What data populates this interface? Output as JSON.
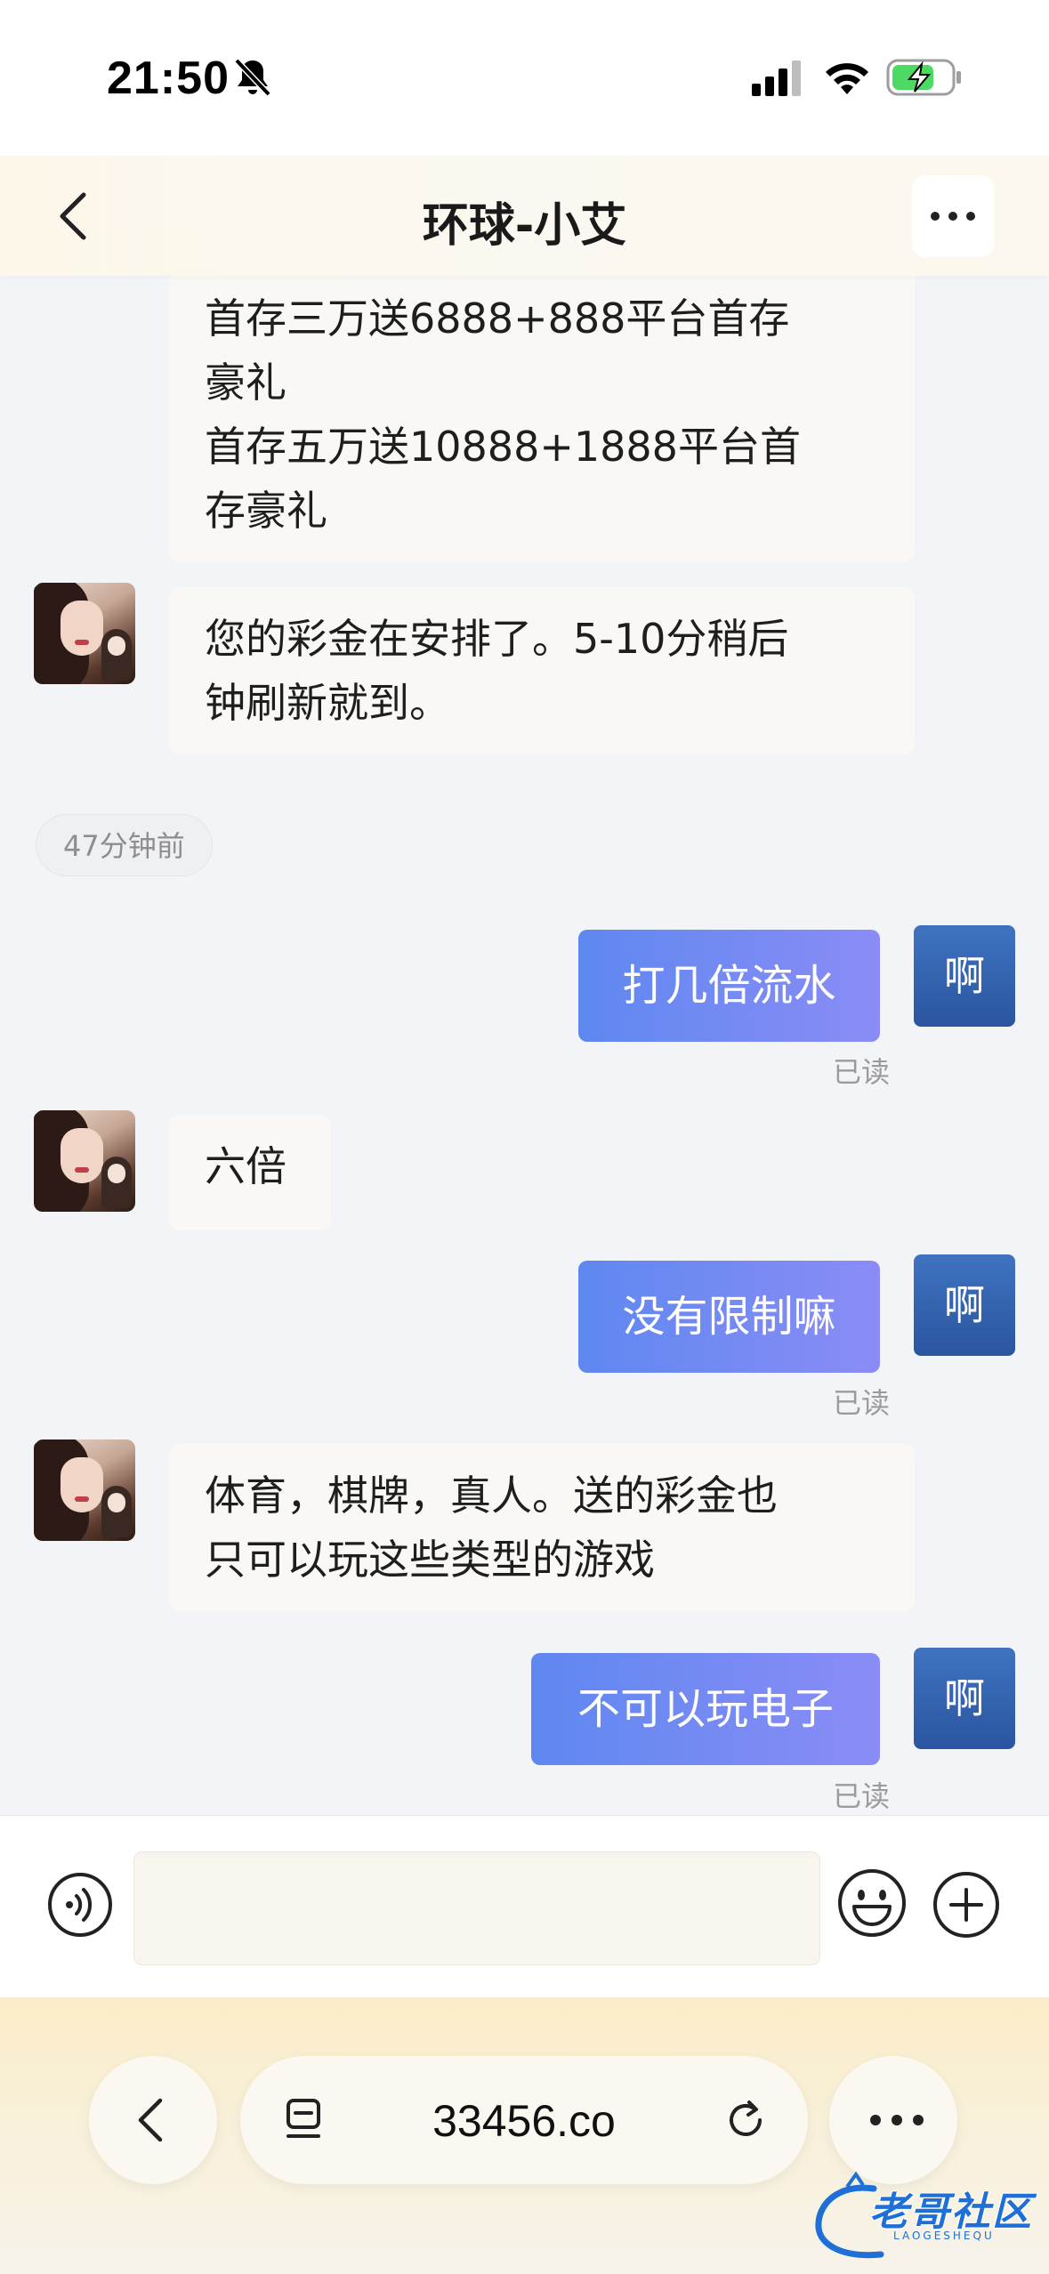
{
  "status_bar": {
    "time": "21:50"
  },
  "header": {
    "title": "环球-小艾"
  },
  "messages": {
    "m0": {
      "line1": "首存三万送6888+888平台首存",
      "line2": "豪礼",
      "line3": "首存五万送10888+1888平台首",
      "line4": "存豪礼"
    },
    "m1": {
      "line1": "您的彩金在安排了。5-10分稍后",
      "line2": "钟刷新就到。"
    },
    "time_chip": "47分钟前",
    "m2": {
      "text": "打几倍流水",
      "read": "已读"
    },
    "m3": {
      "text": "六倍"
    },
    "m4": {
      "text": "没有限制嘛",
      "read": "已读"
    },
    "m5": {
      "line1": "体育，棋牌，真人。送的彩金也",
      "line2": "只可以玩这些类型的游戏"
    },
    "m6": {
      "text": "不可以玩电子",
      "read": "已读"
    },
    "self_avatar_text": "啊"
  },
  "input": {
    "value": "",
    "placeholder": ""
  },
  "browser": {
    "url": "33456.co"
  },
  "watermark": {
    "text": "老哥社区",
    "sub": "LAOGESHEQU"
  },
  "colors": {
    "outgoing_bubble_start": "#5e88f0",
    "outgoing_bubble_end": "#8b8cf6",
    "self_avatar": "#3f73c0",
    "incoming_bubble": "#f9f8f4",
    "battery_charge": "#4cd964"
  },
  "icons": [
    "bell-off-icon",
    "signal-icon",
    "wifi-icon",
    "battery-icon",
    "back-icon",
    "more-icon",
    "voice-icon",
    "emoji-icon",
    "add-icon",
    "tabs-icon",
    "reload-icon"
  ]
}
